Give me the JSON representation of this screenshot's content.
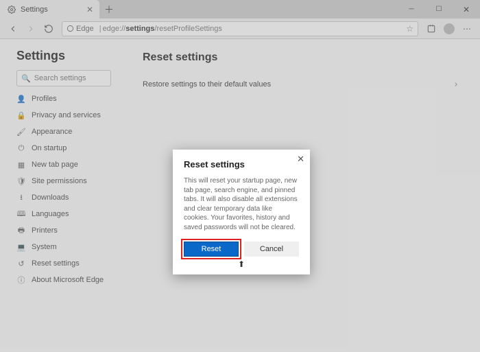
{
  "tab": {
    "title": "Settings"
  },
  "address": {
    "product": "Edge",
    "url_bold": "settings",
    "url_rest": "edge://",
    "url_tail": "/resetProfileSettings"
  },
  "sidebar": {
    "title": "Settings",
    "search_placeholder": "Search settings",
    "items": [
      {
        "icon": "profile-icon",
        "glyph": "👤",
        "label": "Profiles"
      },
      {
        "icon": "lock-icon",
        "glyph": "🔒",
        "label": "Privacy and services"
      },
      {
        "icon": "appearance-icon",
        "glyph": "🖌",
        "label": "Appearance"
      },
      {
        "icon": "power-icon",
        "glyph": "⏻",
        "label": "On startup"
      },
      {
        "icon": "newtab-icon",
        "glyph": "▦",
        "label": "New tab page"
      },
      {
        "icon": "permissions-icon",
        "glyph": "🛡",
        "label": "Site permissions"
      },
      {
        "icon": "download-icon",
        "glyph": "⭳",
        "label": "Downloads"
      },
      {
        "icon": "language-icon",
        "glyph": "🕮",
        "label": "Languages"
      },
      {
        "icon": "printer-icon",
        "glyph": "🖶",
        "label": "Printers"
      },
      {
        "icon": "system-icon",
        "glyph": "💻",
        "label": "System"
      },
      {
        "icon": "reset-icon",
        "glyph": "↺",
        "label": "Reset settings"
      },
      {
        "icon": "about-icon",
        "glyph": "ⓘ",
        "label": "About Microsoft Edge"
      }
    ]
  },
  "main": {
    "title": "Reset settings",
    "row_label": "Restore settings to their default values"
  },
  "dialog": {
    "title": "Reset settings",
    "body": "This will reset your startup page, new tab page, search engine, and pinned tabs. It will also disable all extensions and clear temporary data like cookies. Your favorites, history and saved passwords will not be cleared.",
    "primary": "Reset",
    "secondary": "Cancel"
  }
}
